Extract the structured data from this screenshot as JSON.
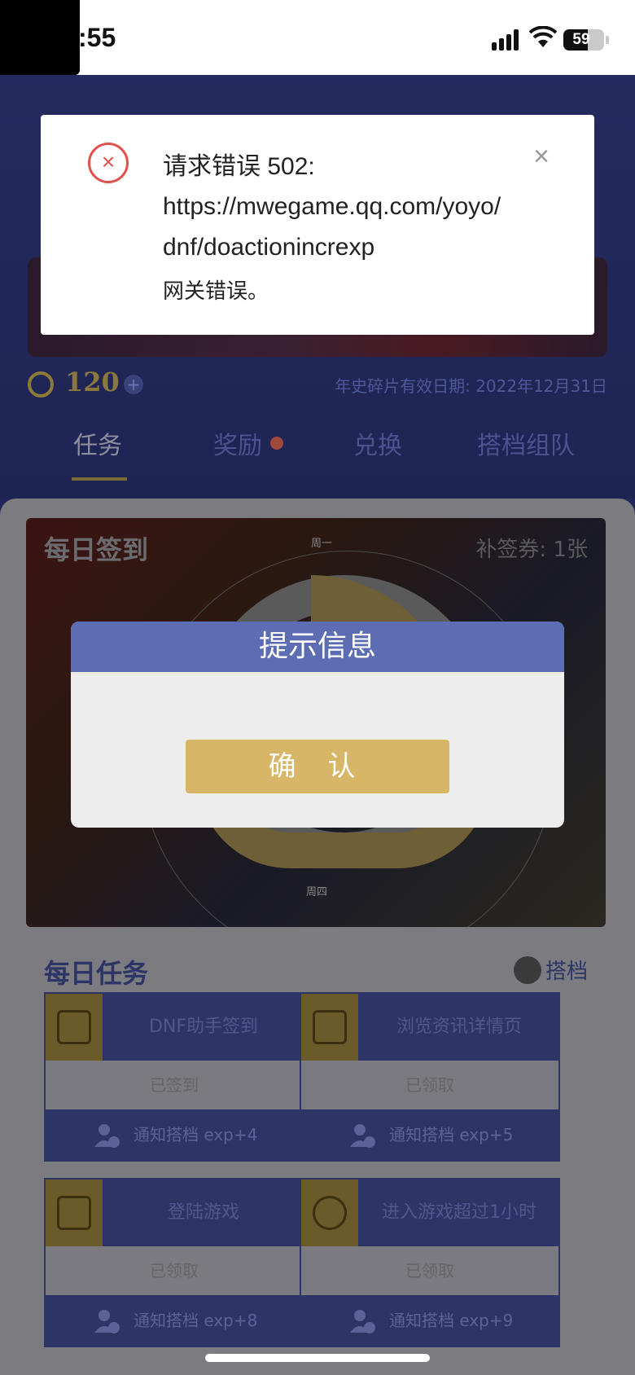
{
  "status_bar": {
    "time": ":55",
    "battery": "59"
  },
  "header": {
    "coins": "120",
    "expiry": "年史碎片有效日期: 2022年12月31日"
  },
  "tabs": [
    {
      "label": "任务",
      "active": true
    },
    {
      "label": "奖励",
      "badge": true
    },
    {
      "label": "兑换"
    },
    {
      "label": "搭档组队"
    }
  ],
  "signin": {
    "title": "每日签到",
    "makeup": "补签券: 1张",
    "days": [
      "周一",
      "周四"
    ]
  },
  "daily_tasks": {
    "title": "每日任务",
    "partner_label": "搭档",
    "items": [
      {
        "name": "DNF助手签到",
        "status": "已签到",
        "notify": "通知搭档 exp+4",
        "icon": "calendar-icon"
      },
      {
        "name": "浏览资讯详情页",
        "status": "已领取",
        "notify": "通知搭档 exp+5",
        "icon": "scroll-icon"
      },
      {
        "name": "登陆游戏",
        "status": "已领取",
        "notify": "通知搭档 exp+8",
        "icon": "monitor-icon"
      },
      {
        "name": "进入游戏超过1小时",
        "status": "已领取",
        "notify": "通知搭档 exp+9",
        "icon": "gear-clock-icon"
      }
    ]
  },
  "error_toast": {
    "title": "请求错误 502:",
    "url": "https://mwegame.qq.com/yoyo/dnf/doactionincrexp",
    "message": "网关错误。"
  },
  "modal": {
    "title": "提示信息",
    "confirm": "确 认"
  },
  "colors": {
    "modal_header": "#5d6db3",
    "confirm_button": "#d8b668",
    "error_red": "#e0524d"
  }
}
